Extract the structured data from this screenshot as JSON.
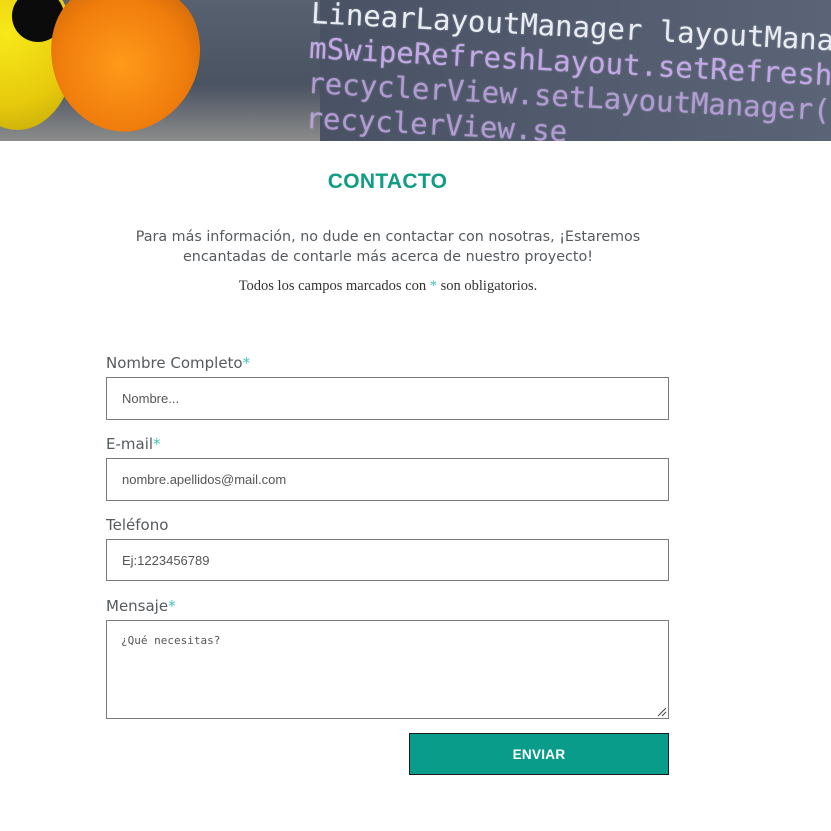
{
  "hero": {
    "code_lines": [
      "LinearLayoutManager layoutManager",
      "mSwipeRefreshLayout.setRefreshing",
      "recyclerView.setLayoutManager(la",
      "recyclerView.se"
    ]
  },
  "contact": {
    "title": "CONTACTO",
    "intro": "Para más información, no dude en contactar con nosotras, ¡Estaremos encantadas de contarle más acerca de nuestro proyecto!",
    "required_note_before": "Todos los campos marcados con",
    "required_note_after": "son obligatorios.",
    "required_marker": "*"
  },
  "form": {
    "name": {
      "label": "Nombre Completo",
      "placeholder": "Nombre..."
    },
    "email": {
      "label": "E-mail",
      "placeholder": "nombre.apellidos@mail.com"
    },
    "phone": {
      "label": "Teléfono",
      "placeholder": "Ej:1223456789"
    },
    "message": {
      "label": "Mensaje",
      "placeholder": "¿Qué necesitas?"
    },
    "submit_label": "ENVIAR"
  },
  "colors": {
    "accent": "#119c86",
    "button": "#0a9c8b",
    "asterisk": "#3fc3b9"
  }
}
